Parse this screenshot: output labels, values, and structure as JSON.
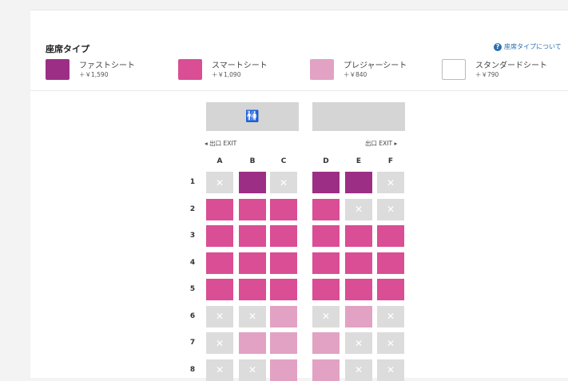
{
  "legend": {
    "title": "座席タイプ",
    "help_link": "座席タイプについて",
    "types": [
      {
        "key": "first",
        "name": "ファストシート",
        "price": "＋￥1,590",
        "color": "#9c2f85"
      },
      {
        "key": "smart",
        "name": "スマートシート",
        "price": "＋￥1,090",
        "color": "#d94e94"
      },
      {
        "key": "pleasure",
        "name": "プレジャーシート",
        "price": "＋￥840",
        "color": "#e2a2c3"
      },
      {
        "key": "standard",
        "name": "スタンダードシート",
        "price": "＋￥790",
        "color": "#ffffff"
      }
    ]
  },
  "cabin": {
    "exit_left": "◂ 出口 EXIT",
    "exit_right": "出口 EXIT ▸",
    "lavatory_icon": "lavatory-icon",
    "columns": [
      "A",
      "B",
      "C",
      "D",
      "E",
      "F"
    ],
    "rows": [
      {
        "num": "1",
        "seats": [
          "unavailable",
          "first",
          "unavailable",
          "first",
          "first",
          "unavailable"
        ]
      },
      {
        "num": "2",
        "seats": [
          "smart",
          "smart",
          "smart",
          "smart",
          "unavailable",
          "unavailable"
        ]
      },
      {
        "num": "3",
        "seats": [
          "smart",
          "smart",
          "smart",
          "smart",
          "smart",
          "smart"
        ]
      },
      {
        "num": "4",
        "seats": [
          "smart",
          "smart",
          "smart",
          "smart",
          "smart",
          "smart"
        ]
      },
      {
        "num": "5",
        "seats": [
          "smart",
          "smart",
          "smart",
          "smart",
          "smart",
          "smart"
        ]
      },
      {
        "num": "6",
        "seats": [
          "unavailable",
          "unavailable",
          "pleasure",
          "unavailable",
          "pleasure",
          "unavailable"
        ]
      },
      {
        "num": "7",
        "seats": [
          "unavailable",
          "pleasure",
          "pleasure",
          "pleasure",
          "unavailable",
          "unavailable"
        ]
      },
      {
        "num": "8",
        "seats": [
          "unavailable",
          "unavailable",
          "pleasure",
          "pleasure",
          "unavailable",
          "unavailable"
        ]
      }
    ]
  }
}
